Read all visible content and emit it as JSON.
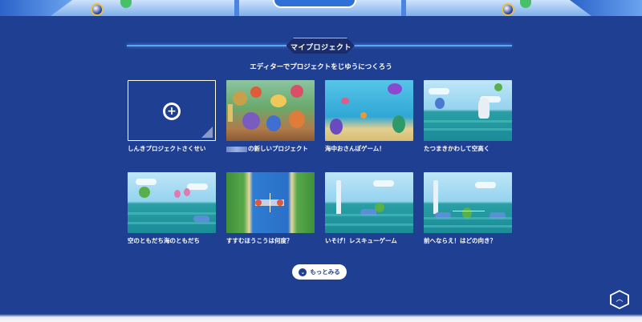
{
  "section": {
    "title": "マイプロジェクト",
    "subtitle": "エディターでプロジェクトをじゆうにつくろう"
  },
  "projects": [
    {
      "label": "しんきプロジェクトさくせい",
      "kind": "new"
    },
    {
      "label": "の新しいプロジェクト",
      "kind": "battle",
      "name_redacted": true
    },
    {
      "label": "海中おさんぽゲーム！",
      "kind": "underwater"
    },
    {
      "label": "たつまきかわして空高く",
      "kind": "sea"
    },
    {
      "label": "空のともだち海のともだち",
      "kind": "sea"
    },
    {
      "label": "すすむほうこうは何度？",
      "kind": "map"
    },
    {
      "label": "いそげ！レスキューゲーム",
      "kind": "sea"
    },
    {
      "label": "前へならえ！はどの向き？",
      "kind": "sea"
    }
  ],
  "more_button": {
    "label": "もっとみる",
    "icon": "chevron-down-icon"
  },
  "to_top": {
    "icon": "chevron-up-icon",
    "glyph": "︿"
  },
  "new_project": {
    "icon": "plus-icon",
    "glyph": "+"
  },
  "colors": {
    "background": "#1f3f92",
    "accent_line": "#5aa6ff",
    "tab_bg": "#1b2c6d"
  }
}
